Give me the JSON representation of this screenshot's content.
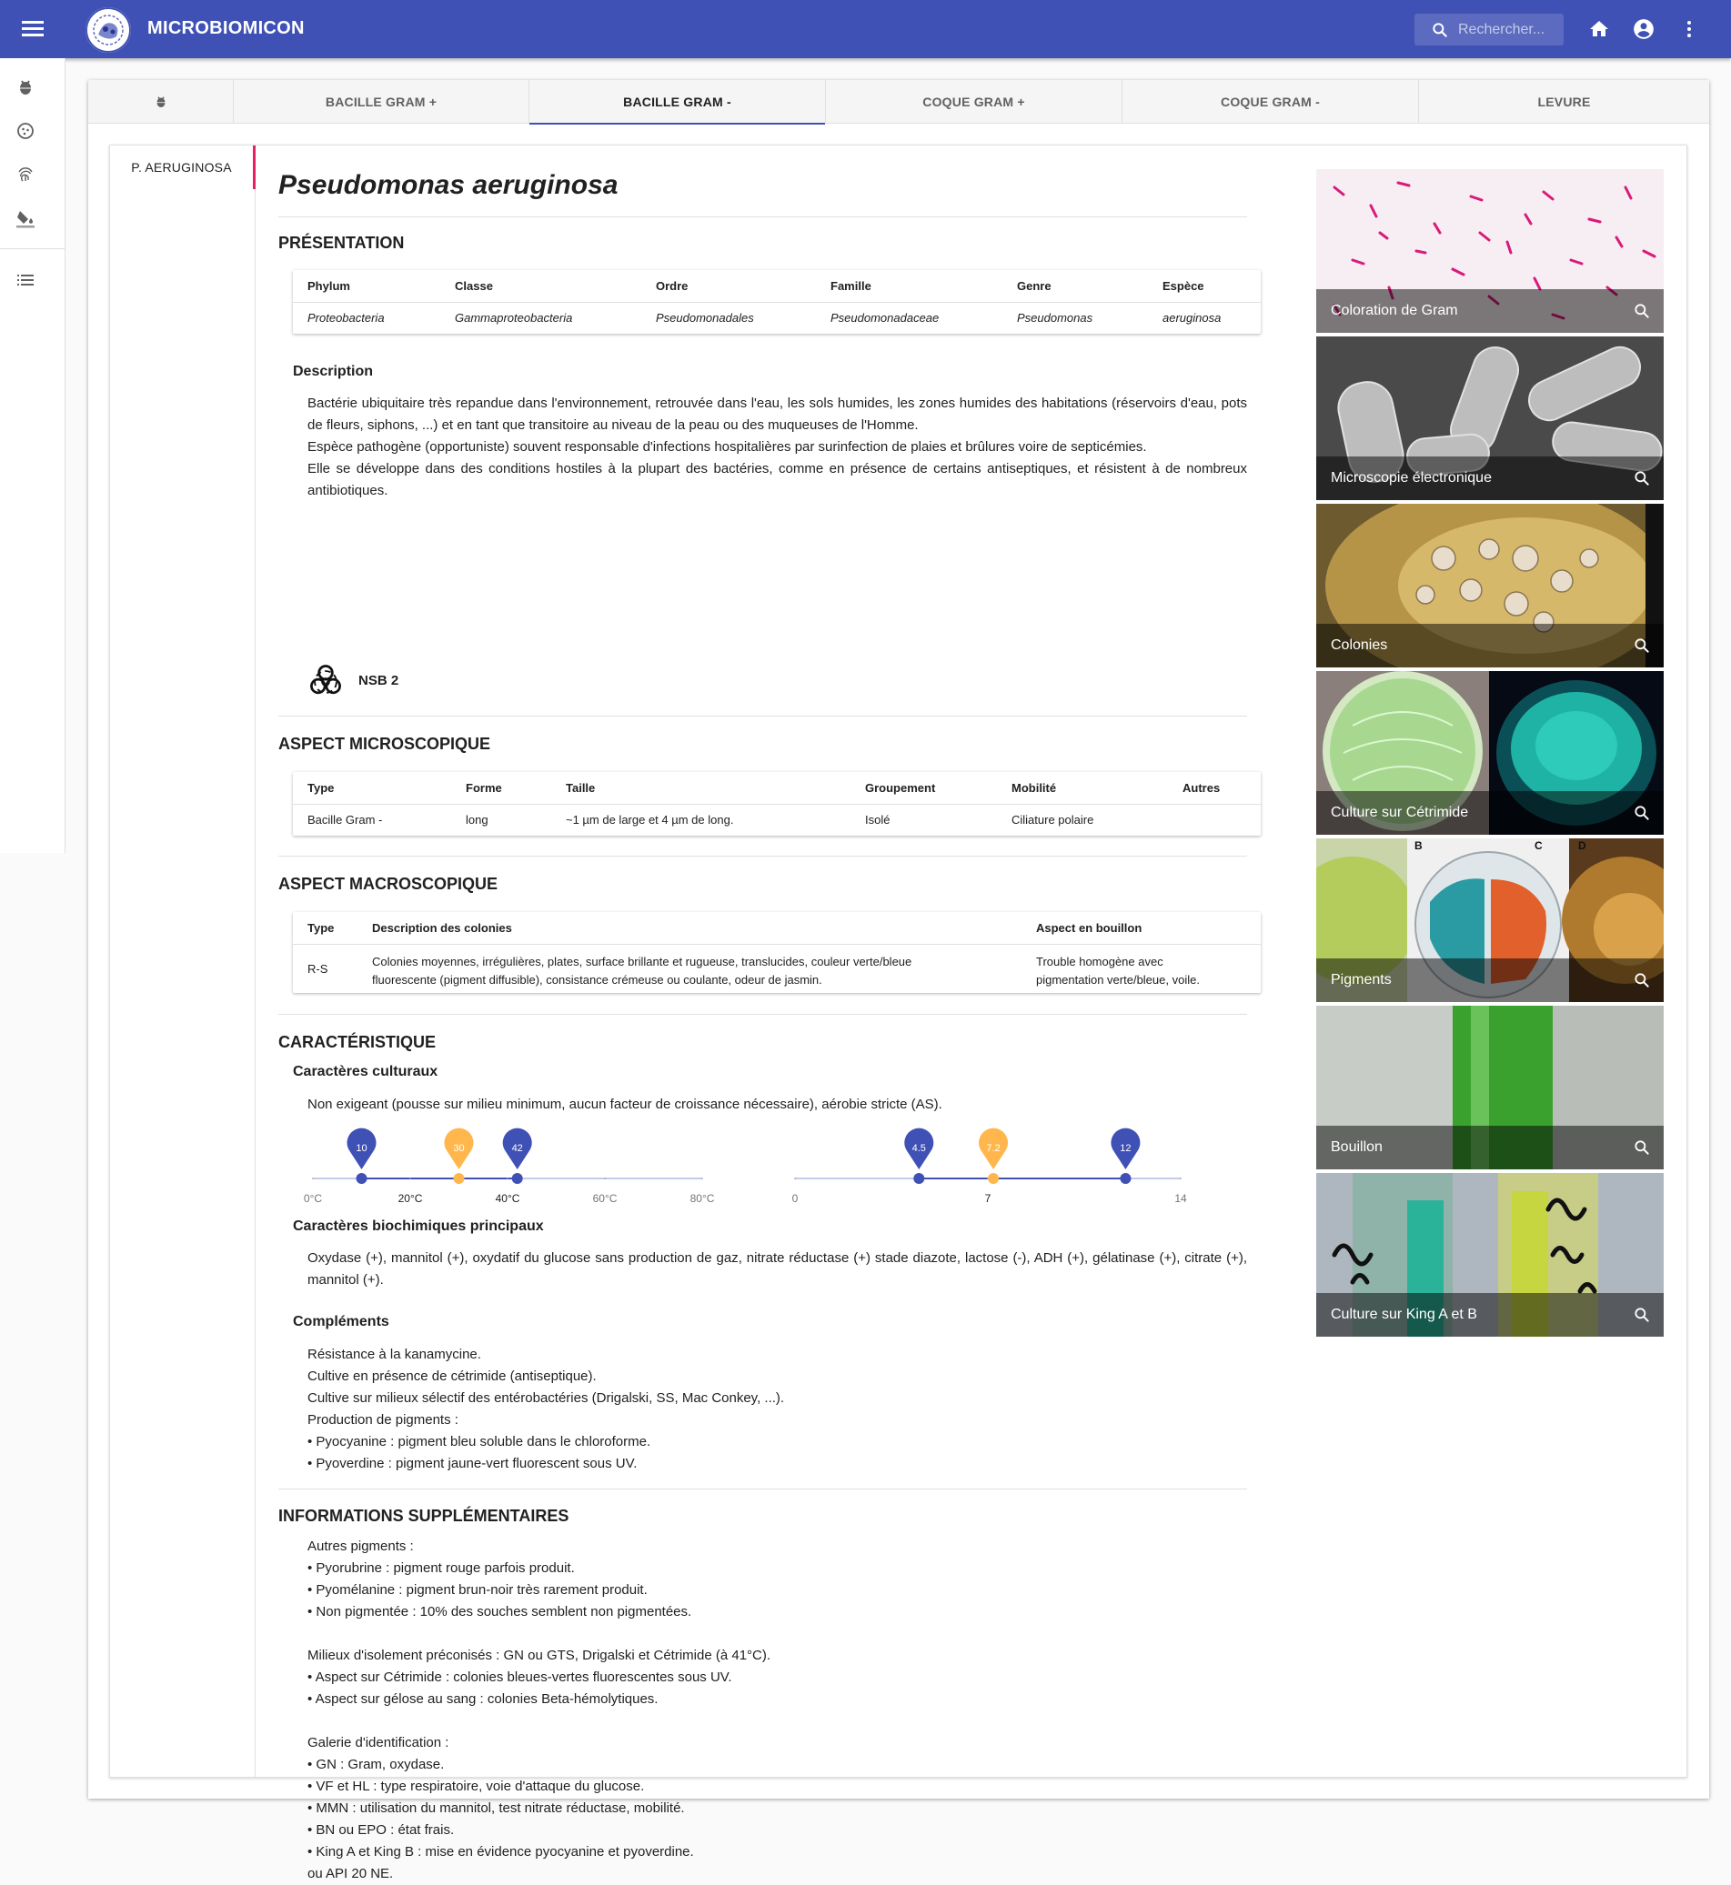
{
  "app": {
    "brand": "MICROBIOMICON",
    "search_placeholder": "Rechercher..."
  },
  "tabs": [
    {
      "label": ""
    },
    {
      "label": "BACILLE GRAM +"
    },
    {
      "label": "BACILLE GRAM -",
      "active": true
    },
    {
      "label": "COQUE GRAM +"
    },
    {
      "label": "COQUE GRAM -"
    },
    {
      "label": "LEVURE"
    }
  ],
  "species_nav": {
    "selected": "P. AERUGINOSA"
  },
  "species": {
    "title": "Pseudomonas aeruginosa",
    "presentation": {
      "heading": "PRÉSENTATION",
      "headers": [
        "Phylum",
        "Classe",
        "Ordre",
        "Famille",
        "Genre",
        "Espèce"
      ],
      "values": [
        "Proteobacteria",
        "Gammaproteobacteria",
        "Pseudomonadales",
        "Pseudomonadaceae",
        "Pseudomonas",
        "aeruginosa"
      ]
    },
    "description": {
      "heading": "Description",
      "lines": [
        "Bactérie ubiquitaire très repandue dans l'environnement, retrouvée dans l'eau, les sols humides, les zones humides des habitations (réservoirs d'eau, pots de fleurs, siphons, ...) et en tant que transitoire au niveau de la peau ou des muqueuses de l'Homme.",
        "Espèce pathogène (opportuniste) souvent responsable d'infections hospitalières par surinfection de plaies et brûlures voire de septicémies.",
        "Elle se développe dans des conditions hostiles à la plupart des bactéries, comme en présence de certains antiseptiques, et résistent à de nombreux antibiotiques."
      ],
      "nsb": "NSB 2"
    },
    "micro": {
      "heading": "ASPECT MICROSCOPIQUE",
      "headers": [
        "Type",
        "Forme",
        "Taille",
        "Groupement",
        "Mobilité",
        "Autres"
      ],
      "values": [
        "Bacille Gram -",
        "long",
        "~1 µm de large et 4 µm de long.",
        "Isolé",
        "Ciliature polaire",
        ""
      ]
    },
    "macro": {
      "heading": "ASPECT MACROSCOPIQUE",
      "headers": [
        "Type",
        "Description des colonies",
        "Aspect en bouillon"
      ],
      "type": "R-S",
      "desc_lines": [
        "Colonies moyennes, irrégulières, plates, surface brillante et rugueuse, translucides, couleur verte/bleue",
        "fluorescente (pigment diffusible), consistance crémeuse ou coulante, odeur de jasmin."
      ],
      "bouillon_lines": [
        "Trouble homogène avec",
        "pigmentation verte/bleue, voile."
      ]
    },
    "caracteristique": {
      "heading": "CARACTÉRISTIQUE",
      "culture_heading": "Caractères culturaux",
      "culture_text": "Non exigeant (pousse sur milieu minimum, aucun facteur de croissance nécessaire), aérobie stricte (AS).",
      "temperature": {
        "min": 0,
        "max": 80,
        "ticks": [
          "0°C",
          "20°C",
          "40°C",
          "60°C",
          "80°C"
        ],
        "pins": [
          {
            "value": 10,
            "label": "10",
            "color": "#3f51b5"
          },
          {
            "value": 30,
            "label": "30",
            "color": "#ffb74d"
          },
          {
            "value": 42,
            "label": "42",
            "color": "#3f51b5"
          }
        ]
      },
      "ph": {
        "min": 0,
        "max": 14,
        "ticks": [
          "0",
          "7",
          "14"
        ],
        "pins": [
          {
            "value": 4.5,
            "label": "4.5",
            "color": "#3f51b5"
          },
          {
            "value": 7.2,
            "label": "7.2",
            "color": "#ffb74d"
          },
          {
            "value": 12,
            "label": "12",
            "color": "#3f51b5"
          }
        ]
      },
      "biochem_heading": "Caractères biochimiques principaux",
      "biochem_text": "Oxydase (+), mannitol (+), oxydatif du glucose sans production de gaz, nitrate réductase (+) stade diazote, lactose (-), ADH (+), gélatinase (+), citrate (+), mannitol (+).",
      "complements_heading": "Compléments",
      "complements_lines": [
        "Résistance à la kanamycine.",
        "Cultive en présence de cétrimide (antiseptique).",
        "Cultive sur milieux sélectif des entérobactéries (Drigalski, SS, Mac Conkey, ...).",
        "Production de pigments :",
        "• Pyocyanine : pigment bleu soluble dans le chloroforme.",
        "• Pyoverdine : pigment jaune-vert fluorescent sous UV."
      ]
    },
    "infos": {
      "heading": "INFORMATIONS SUPPLÉMENTAIRES",
      "lines": [
        "Autres pigments :",
        "• Pyorubrine : pigment rouge parfois produit.",
        "• Pyomélanine : pigment brun-noir très rarement produit.",
        "• Non pigmentée : 10% des souches semblent non pigmentées.",
        "",
        "Milieux d'isolement préconisés : GN ou GTS, Drigalski et Cétrimide (à 41°C).",
        "• Aspect sur Cétrimide : colonies bleues-vertes fluorescentes sous UV.",
        "• Aspect sur gélose au sang : colonies Beta-hémolytiques.",
        "",
        "Galerie d'identification :",
        "• GN : Gram, oxydase.",
        "• VF et HL : type respiratoire, voie d'attaque du glucose.",
        "• MMN : utilisation du mannitol, test nitrate réductase, mobilité.",
        "• BN ou EPO : état frais.",
        "• King A et King B : mise en évidence pyocyanine et pyoverdine.",
        "ou API 20 NE."
      ]
    }
  },
  "gallery": [
    {
      "caption": "Coloration de Gram"
    },
    {
      "caption": "Microscopie électronique"
    },
    {
      "caption": "Colonies"
    },
    {
      "caption": "Culture sur Cétrimide"
    },
    {
      "caption": "Pigments",
      "plate_labels": [
        "B",
        "C",
        "D"
      ]
    },
    {
      "caption": "Bouillon"
    },
    {
      "caption": "Culture sur King A et B"
    }
  ],
  "colors": {
    "primary": "#3f51b5",
    "accent_pink": "#e91e63",
    "pin_orange": "#ffb74d"
  }
}
